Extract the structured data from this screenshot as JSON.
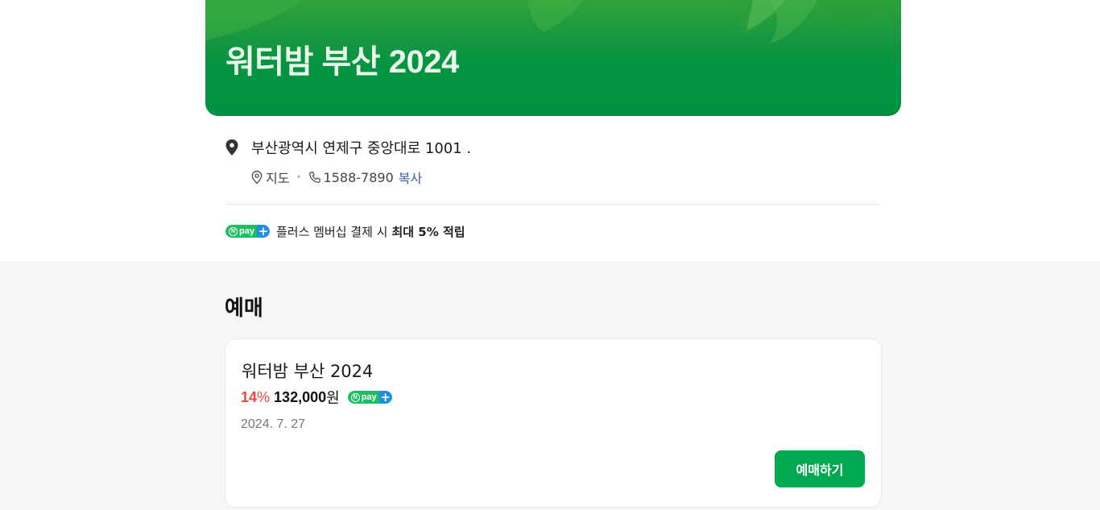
{
  "hero": {
    "title": "워터밤 부산 2024"
  },
  "location": {
    "address": "부산광역시 연제구 중앙대로 1001 .",
    "map_label": "지도",
    "separator": "•",
    "phone": "1588-7890",
    "copy_label": "복사"
  },
  "npay": {
    "badge_n": "N",
    "badge_text": "pay",
    "badge_plus": "+",
    "benefit_text": "플러스 멤버십 결제 시",
    "benefit_bold": "최대 5% 적립"
  },
  "booking": {
    "section_title": "예매",
    "card": {
      "title": "워터밤 부산 2024",
      "discount_value": "14",
      "discount_unit": "%",
      "price": "132,000",
      "currency": "원",
      "date": "2024. 7. 27",
      "button_label": "예매하기"
    }
  },
  "colors": {
    "brand_green": "#00a84f",
    "hero_green": "#009240",
    "discount_red": "#f0453b",
    "link_blue": "#3b5ea8",
    "npay_green": "#1fbd62",
    "npay_blue": "#1f8fe3"
  },
  "icons": [
    "location-pin-icon",
    "map-outline-icon",
    "phone-icon",
    "npay-plus-icon"
  ]
}
